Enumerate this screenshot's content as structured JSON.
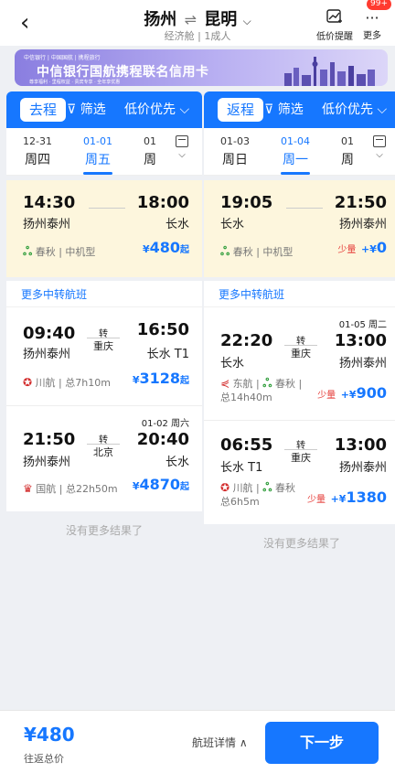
{
  "header": {
    "back_icon": "chevron-left-icon",
    "from_city": "扬州",
    "swap_symbol": "⇌",
    "to_city": "昆明",
    "chevron": "⌵",
    "subtitle": "经济舱 | 1成人",
    "remind_label": "低价提醒",
    "more_label": "更多",
    "more_badge": "99+"
  },
  "banner": {
    "title": "中信银行国航携程联名信用卡",
    "logos": "中信银行 | 中国国航 | 携程旅行",
    "tags": "尊享福利 · 里程权益 · 贵宾专享 · 全年享优惠"
  },
  "outbound": {
    "trip_label": "去程",
    "filter_label": "筛选",
    "sort_label": "低价优先",
    "dates": [
      {
        "date": "12-31",
        "weekday": "周四",
        "active": false
      },
      {
        "date": "01-01",
        "weekday": "周五",
        "active": true
      },
      {
        "date": "01",
        "weekday": "周",
        "active": false
      }
    ],
    "direct": {
      "dep_time": "14:30",
      "dep_airport": "扬州泰州",
      "arr_time": "18:00",
      "arr_airport": "长水",
      "airline": "春秋",
      "aircraft": "中机型",
      "currency": "¥",
      "price": "480",
      "price_suffix": "起"
    },
    "section_title": "更多中转航班",
    "transfers": [
      {
        "dep_time": "09:40",
        "dep_airport": "扬州泰州",
        "transfer_label": "转",
        "via": "重庆",
        "arr_time": "16:50",
        "arr_airport": "长水 T1",
        "airline": "川航",
        "duration": "总7h10m",
        "currency": "¥",
        "price": "3128",
        "price_suffix": "起"
      },
      {
        "next_day": "01-02 周六",
        "dep_time": "21:50",
        "dep_airport": "扬州泰州",
        "transfer_label": "转",
        "via": "北京",
        "arr_time": "20:40",
        "arr_airport": "长水",
        "airline": "国航",
        "duration": "总22h50m",
        "currency": "¥",
        "price": "4870",
        "price_suffix": "起"
      }
    ],
    "no_more": "没有更多结果了"
  },
  "return": {
    "trip_label": "返程",
    "filter_label": "筛选",
    "sort_label": "低价优先",
    "dates": [
      {
        "date": "01-03",
        "weekday": "周日",
        "active": false
      },
      {
        "date": "01-04",
        "weekday": "周一",
        "active": true
      },
      {
        "date": "01",
        "weekday": "周",
        "active": false
      }
    ],
    "direct": {
      "dep_time": "19:05",
      "dep_airport": "长水",
      "arr_time": "21:50",
      "arr_airport": "扬州泰州",
      "airline": "春秋",
      "aircraft": "中机型",
      "scarce": "少量",
      "plus": "+¥",
      "price": "0"
    },
    "section_title": "更多中转航班",
    "transfers": [
      {
        "next_day": "01-05 周二",
        "dep_time": "22:20",
        "dep_airport": "长水",
        "transfer_label": "转",
        "via": "重庆",
        "arr_time": "13:00",
        "arr_airport": "扬州泰州",
        "airline1": "东航",
        "airline2": "春秋",
        "duration": "总14h40m",
        "scarce": "少量",
        "plus": "+¥",
        "price": "900"
      },
      {
        "dep_time": "06:55",
        "dep_airport": "长水 T1",
        "transfer_label": "转",
        "via": "重庆",
        "arr_time": "13:00",
        "arr_airport": "扬州泰州",
        "airline1": "川航",
        "airline2": "春秋",
        "duration": "总6h5m",
        "scarce": "少量",
        "plus": "+¥",
        "price": "1380"
      }
    ],
    "no_more": "没有更多结果了"
  },
  "footer": {
    "total_price": "¥480",
    "total_label": "往返总价",
    "detail_label": "航班详情 ∧",
    "next_label": "下一步"
  },
  "colors": {
    "accent": "#1677ff",
    "selected_bg": "#fdf6dd",
    "warn": "#e53935",
    "spring_green": "#2e9d3a"
  }
}
